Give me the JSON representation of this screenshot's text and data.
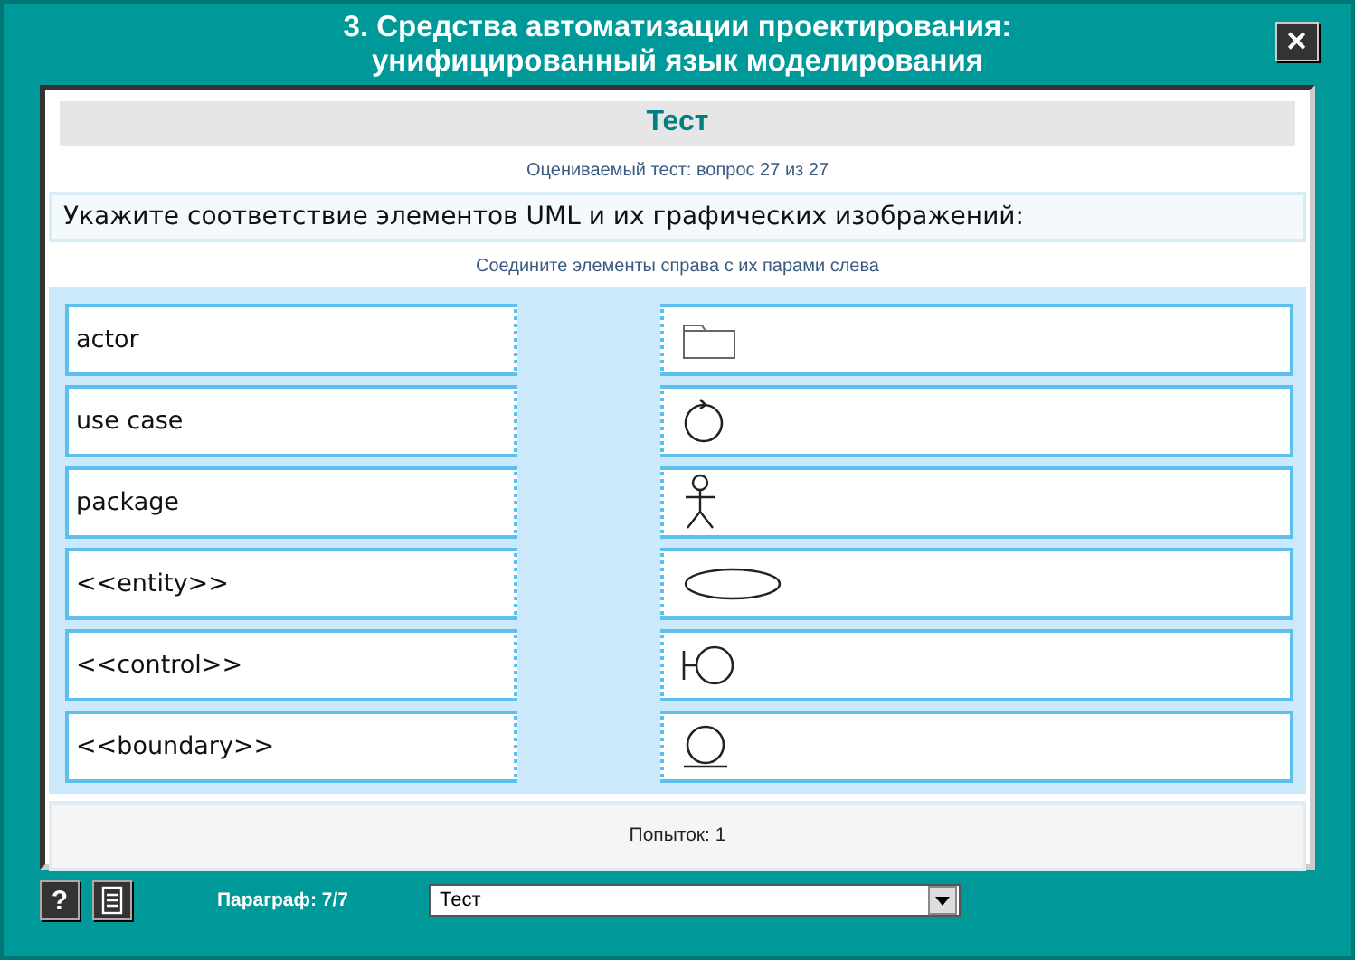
{
  "window": {
    "title_lines": [
      "3. Средства автоматизации проектирования:",
      "унифицированный язык моделирования"
    ],
    "close": "✕"
  },
  "panel": {
    "heading": "Тест",
    "subtitle": "Оцениваемый тест: вопрос 27 из 27",
    "question": "Укажите соответствие элементов UML и их графических изображений:",
    "instruction": "Соедините элементы справа с их парами слева",
    "left": [
      "actor",
      "use case",
      "package",
      "<<entity>>",
      "<<control>>",
      "<<boundary>>"
    ],
    "right": [
      {
        "kind": "folder"
      },
      {
        "kind": "arrow-circle"
      },
      {
        "kind": "stick-figure"
      },
      {
        "kind": "ellipse"
      },
      {
        "kind": "bar-circle"
      },
      {
        "kind": "underlined-circle"
      }
    ],
    "attempts": "Попыток: 1"
  },
  "bottom": {
    "help": "?",
    "paragraph": "Параграф: 7/7",
    "select": "Тест"
  }
}
